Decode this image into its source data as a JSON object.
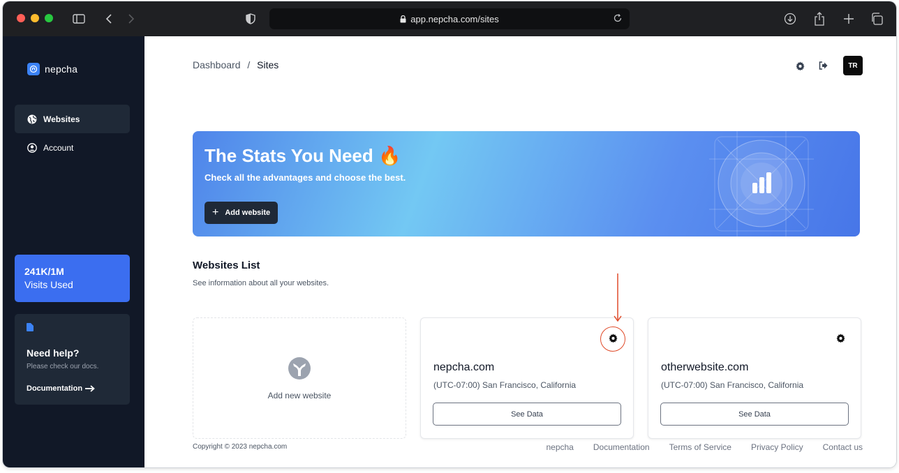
{
  "browser": {
    "url": "app.nepcha.com/sites"
  },
  "sidebar": {
    "brand": "nepcha",
    "items": [
      {
        "label": "Websites",
        "icon": "globe-icon",
        "active": true
      },
      {
        "label": "Account",
        "icon": "user-circle-icon",
        "active": false
      }
    ],
    "usage": {
      "value": "241K/1M",
      "label": "Visits Used"
    },
    "help": {
      "title": "Need help?",
      "subtitle": "Please check our docs.",
      "link": "Documentation"
    }
  },
  "header": {
    "breadcrumb_root": "Dashboard",
    "breadcrumb_sep": "/",
    "breadcrumb_current": "Sites",
    "avatar": "TR"
  },
  "banner": {
    "title": "The Stats You Need 🔥",
    "subtitle": "Check all the advantages and choose the best.",
    "button": "Add website"
  },
  "websites": {
    "title": "Websites List",
    "subtitle": "See information about all your websites.",
    "add_label": "Add new website",
    "cards": [
      {
        "name": "nepcha.com",
        "timezone": "(UTC-07:00) San Francisco, California",
        "button": "See Data",
        "highlighted": true
      },
      {
        "name": "otherwebsite.com",
        "timezone": "(UTC-07:00) San Francisco, California",
        "button": "See Data",
        "highlighted": false
      }
    ]
  },
  "footer": {
    "copyright": "Copyright © 2023 nepcha.com",
    "links": [
      "nepcha",
      "Documentation",
      "Terms of Service",
      "Privacy Policy",
      "Contact us"
    ]
  },
  "colors": {
    "sidebar_bg": "#111827",
    "accent": "#3b6ef0",
    "annotation": "#e04b2a"
  }
}
